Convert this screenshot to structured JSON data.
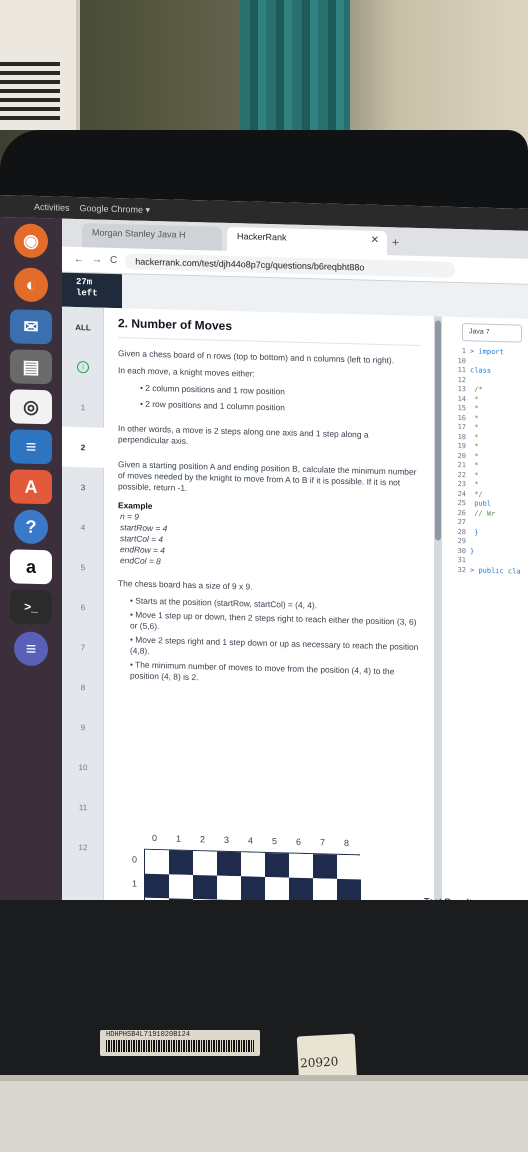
{
  "system": {
    "activities": "Activities",
    "browser_app": "Google Chrome ▾"
  },
  "tabs": [
    {
      "label": "Morgan Stanley Java H",
      "close": "✕"
    },
    {
      "label": "HackerRank",
      "close": "✕"
    }
  ],
  "nav": {
    "back": "←",
    "forward": "→",
    "reload": "C",
    "new_tab": "+"
  },
  "url": "hackerrank.com/test/djh44o8p7cg/questions/b6reqbht88o",
  "timer": {
    "value": "27m",
    "unit": "left"
  },
  "questions": {
    "all": "ALL",
    "items": [
      "1",
      "2",
      "3",
      "4",
      "5",
      "6",
      "7",
      "8",
      "9",
      "10",
      "11",
      "12"
    ]
  },
  "problem": {
    "title": "2. Number of Moves",
    "p1": "Given a chess board of n rows (top to bottom) and n columns (left to right).",
    "p2": "In each move, a knight moves either:",
    "moves": [
      "2 column positions and 1 row position",
      "2 row positions and 1 column position"
    ],
    "p3": "In other words, a move is 2 steps along one axis and 1 step along a perpendicular axis.",
    "p4": "Given a starting position A and ending position B, calculate the minimum number of moves needed by the knight to move from A to B if it is possible. If it is not possible, return -1.",
    "example_title": "Example",
    "example_lines": [
      "n = 9",
      "startRow = 4",
      "startCol = 4",
      "endRow = 4",
      "endCol = 8"
    ],
    "board_size": "The chess board has a size of  9 x 9.",
    "explanation": [
      "Starts at the position (startRow, startCol) = (4, 4).",
      "Move 1 step up or down, then 2 steps right to reach either the position (3, 6) or (5,6).",
      "Move 2 steps right and 1 step down or up as necessary to reach the position (4,8).",
      "The minimum number of moves to move from the position (4, 4) to the position (4, 8) is 2."
    ],
    "col_labels": [
      "0",
      "1",
      "2",
      "3",
      "4",
      "5",
      "6",
      "7",
      "8"
    ],
    "row_labels": [
      "0",
      "1",
      "2"
    ],
    "board_dark": "#1f2b4d",
    "board_light": "#ffffff"
  },
  "editor": {
    "language": "Java 7",
    "lines": [
      {
        "n": "1",
        "text": "> import"
      },
      {
        "n": "10",
        "text": ""
      },
      {
        "n": "11",
        "text": "class"
      },
      {
        "n": "12",
        "text": ""
      },
      {
        "n": "13",
        "text": "  /*"
      },
      {
        "n": "14",
        "text": "   *"
      },
      {
        "n": "15",
        "text": "   *"
      },
      {
        "n": "16",
        "text": "   *"
      },
      {
        "n": "17",
        "text": "   *"
      },
      {
        "n": "18",
        "text": "   *"
      },
      {
        "n": "19",
        "text": "   *"
      },
      {
        "n": "20",
        "text": "   *"
      },
      {
        "n": "21",
        "text": "   *"
      },
      {
        "n": "22",
        "text": "   *"
      },
      {
        "n": "23",
        "text": "   *"
      },
      {
        "n": "24",
        "text": "   */"
      },
      {
        "n": "25",
        "text": "  publ"
      },
      {
        "n": "26",
        "text": "  // Wr"
      },
      {
        "n": "27",
        "text": ""
      },
      {
        "n": "28",
        "text": "   }"
      },
      {
        "n": "29",
        "text": ""
      },
      {
        "n": "30",
        "text": "}"
      },
      {
        "n": "31",
        "text": ""
      },
      {
        "n": "32",
        "text": "> public cla"
      }
    ],
    "test_results": "Test Results"
  },
  "sticker": {
    "serial": "HDHPHSB4L7191020B124",
    "handwritten": "20920"
  }
}
